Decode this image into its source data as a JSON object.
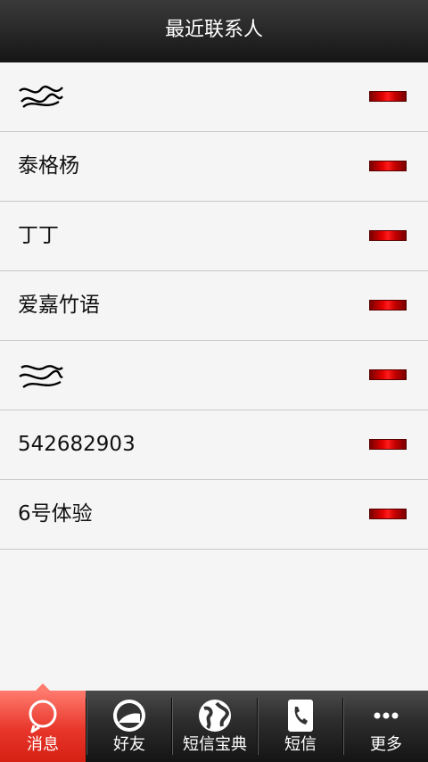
{
  "header": {
    "title": "最近联系人"
  },
  "contacts": [
    {
      "name": ""
    },
    {
      "name": "泰格杨"
    },
    {
      "name": "丁丁"
    },
    {
      "name": "爱嘉竹语"
    },
    {
      "name": ""
    },
    {
      "name": "542682903"
    },
    {
      "name": "6号体验"
    }
  ],
  "tabs": [
    {
      "label": "消息",
      "icon": "message-icon"
    },
    {
      "label": "好友",
      "icon": "friend-icon"
    },
    {
      "label": "短信宝典",
      "icon": "globe-icon"
    },
    {
      "label": "短信",
      "icon": "phone-icon"
    },
    {
      "label": "更多",
      "icon": "more-icon"
    }
  ],
  "colors": {
    "accent": "#e8362a",
    "badge": "#e10000",
    "header": "#2a2a2a"
  }
}
